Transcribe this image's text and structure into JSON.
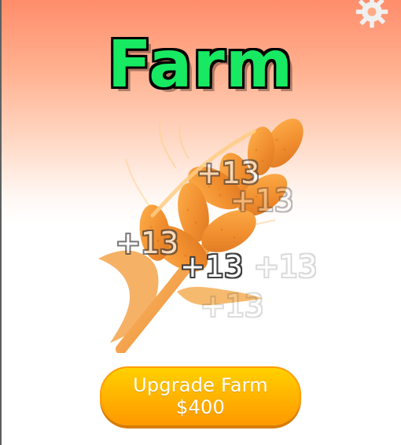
{
  "title": "Farm",
  "settings_icon": "gear-icon",
  "crop_icon": "wheat-icon",
  "floating_texts": [
    "+13",
    "+13",
    "+13",
    "+13",
    "+13",
    "+13"
  ],
  "upgrade_button": {
    "label_line1": "Upgrade Farm",
    "label_line2": "$400"
  },
  "colors": {
    "title_green": "#17ea62",
    "wheat_orange": "#e98a2e",
    "button_orange": "#ffbc00",
    "background_top": "#ff8d6b"
  }
}
